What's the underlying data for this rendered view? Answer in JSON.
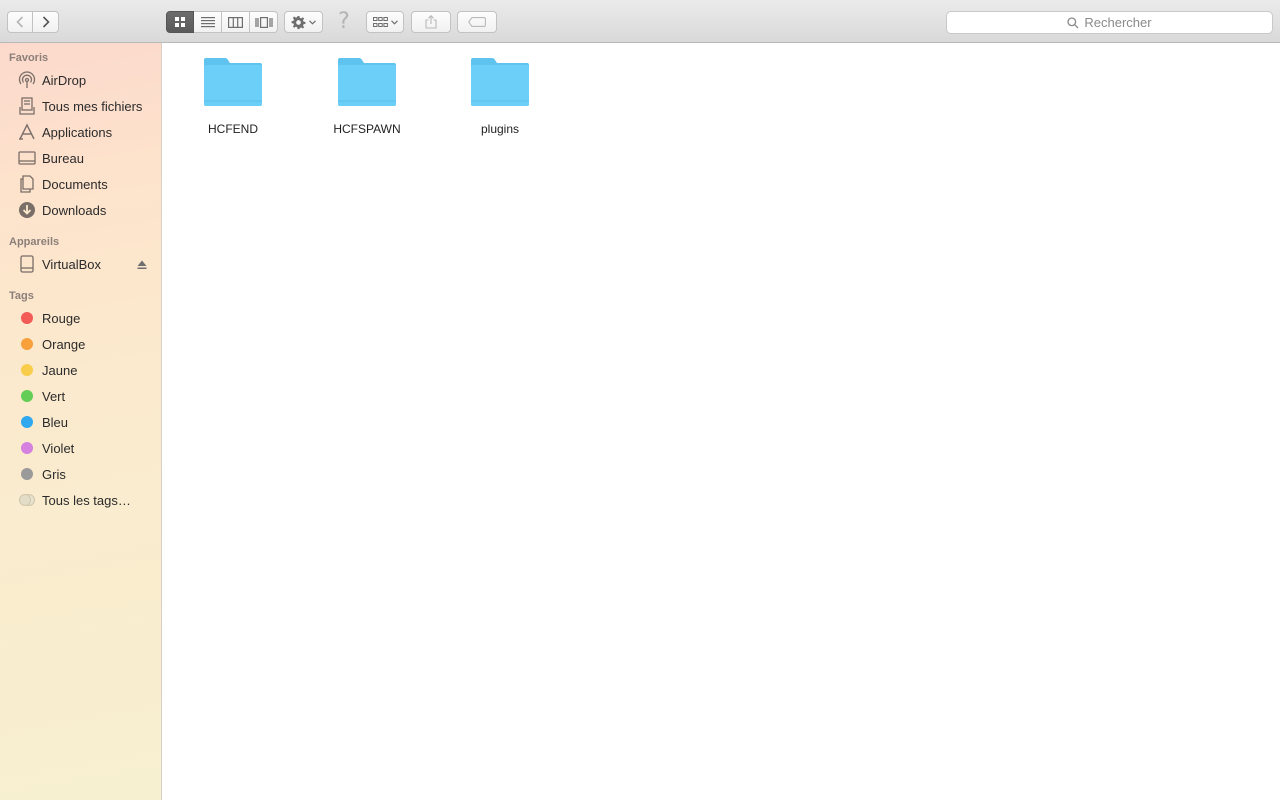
{
  "toolbar": {
    "search_placeholder": "Rechercher",
    "help_glyph": "?"
  },
  "sidebar": {
    "favorites_title": "Favoris",
    "favorites": [
      {
        "label": "AirDrop",
        "icon": "airdrop-icon"
      },
      {
        "label": "Tous mes fichiers",
        "icon": "all-files-icon"
      },
      {
        "label": "Applications",
        "icon": "applications-icon"
      },
      {
        "label": "Bureau",
        "icon": "desktop-icon"
      },
      {
        "label": "Documents",
        "icon": "documents-icon"
      },
      {
        "label": "Downloads",
        "icon": "downloads-icon"
      }
    ],
    "devices_title": "Appareils",
    "devices": [
      {
        "label": "VirtualBox",
        "icon": "disk-icon"
      }
    ],
    "tags_title": "Tags",
    "tags": [
      {
        "label": "Rouge",
        "color": "#f25b56"
      },
      {
        "label": "Orange",
        "color": "#f7a03c"
      },
      {
        "label": "Jaune",
        "color": "#f9cd4c"
      },
      {
        "label": "Vert",
        "color": "#63cd55"
      },
      {
        "label": "Bleu",
        "color": "#2fa8f0"
      },
      {
        "label": "Violet",
        "color": "#d481e0"
      },
      {
        "label": "Gris",
        "color": "#9a9a9a"
      },
      {
        "label": "Tous les tags…",
        "color": "#e3dcc7"
      }
    ]
  },
  "content": {
    "items": [
      {
        "name": "HCFEND",
        "type": "folder"
      },
      {
        "name": "HCFSPAWN",
        "type": "folder"
      },
      {
        "name": "plugins",
        "type": "folder"
      }
    ],
    "folder_color": "#6ccff7"
  }
}
